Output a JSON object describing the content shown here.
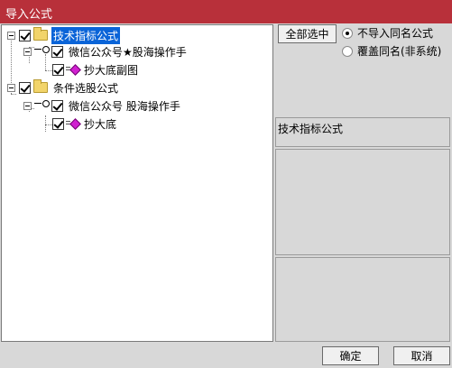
{
  "window": {
    "title": "导入公式"
  },
  "tree": {
    "nodes": [
      {
        "label": "技术指标公式",
        "checked": true,
        "selected": true,
        "icon": "folder-icon"
      },
      {
        "label": "微信公众号★股海操作手",
        "checked": true,
        "icon": "key-icon"
      },
      {
        "label": "抄大底副图",
        "checked": true,
        "icon": "gem-icon"
      },
      {
        "label": "条件选股公式",
        "checked": true,
        "icon": "folder-icon"
      },
      {
        "label": "微信公众号 股海操作手",
        "checked": true,
        "icon": "key-icon"
      },
      {
        "label": "抄大底",
        "checked": true,
        "icon": "gem-icon"
      }
    ]
  },
  "side": {
    "select_all_label": "全部选中",
    "options": [
      {
        "label": "不导入同名公式",
        "checked": true
      },
      {
        "label": "覆盖同名(非系统)",
        "checked": false
      }
    ],
    "info_title": "技术指标公式"
  },
  "footer": {
    "ok_label": "确定",
    "cancel_label": "取消"
  }
}
